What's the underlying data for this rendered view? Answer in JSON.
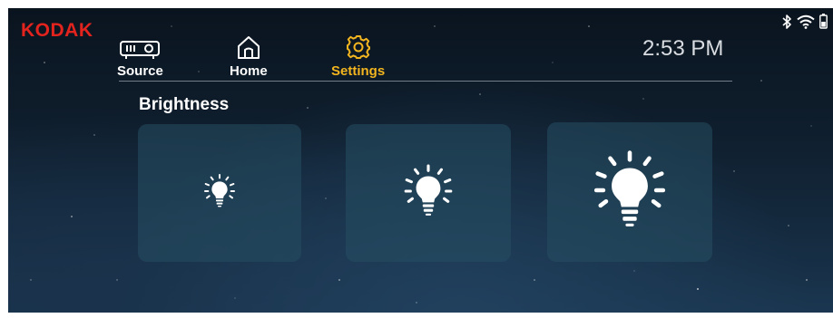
{
  "brand": {
    "name": "KODAK",
    "color": "#e3231d"
  },
  "nav": {
    "items": [
      {
        "id": "source",
        "label": "Source",
        "icon": "projector-icon",
        "active": false
      },
      {
        "id": "home",
        "label": "Home",
        "icon": "home-icon",
        "active": false
      },
      {
        "id": "settings",
        "label": "Settings",
        "icon": "gear-icon",
        "active": true
      }
    ],
    "active_color": "#f3b51f"
  },
  "clock": {
    "time": "2:53 PM"
  },
  "status_bar": {
    "icons": [
      "bluetooth-icon",
      "wifi-icon",
      "battery-icon"
    ]
  },
  "section": {
    "title": "Brightness"
  },
  "brightness": {
    "levels": [
      {
        "id": "low",
        "icon": "lightbulb-small-icon"
      },
      {
        "id": "medium",
        "icon": "lightbulb-medium-icon"
      },
      {
        "id": "high",
        "icon": "lightbulb-large-icon"
      }
    ]
  }
}
